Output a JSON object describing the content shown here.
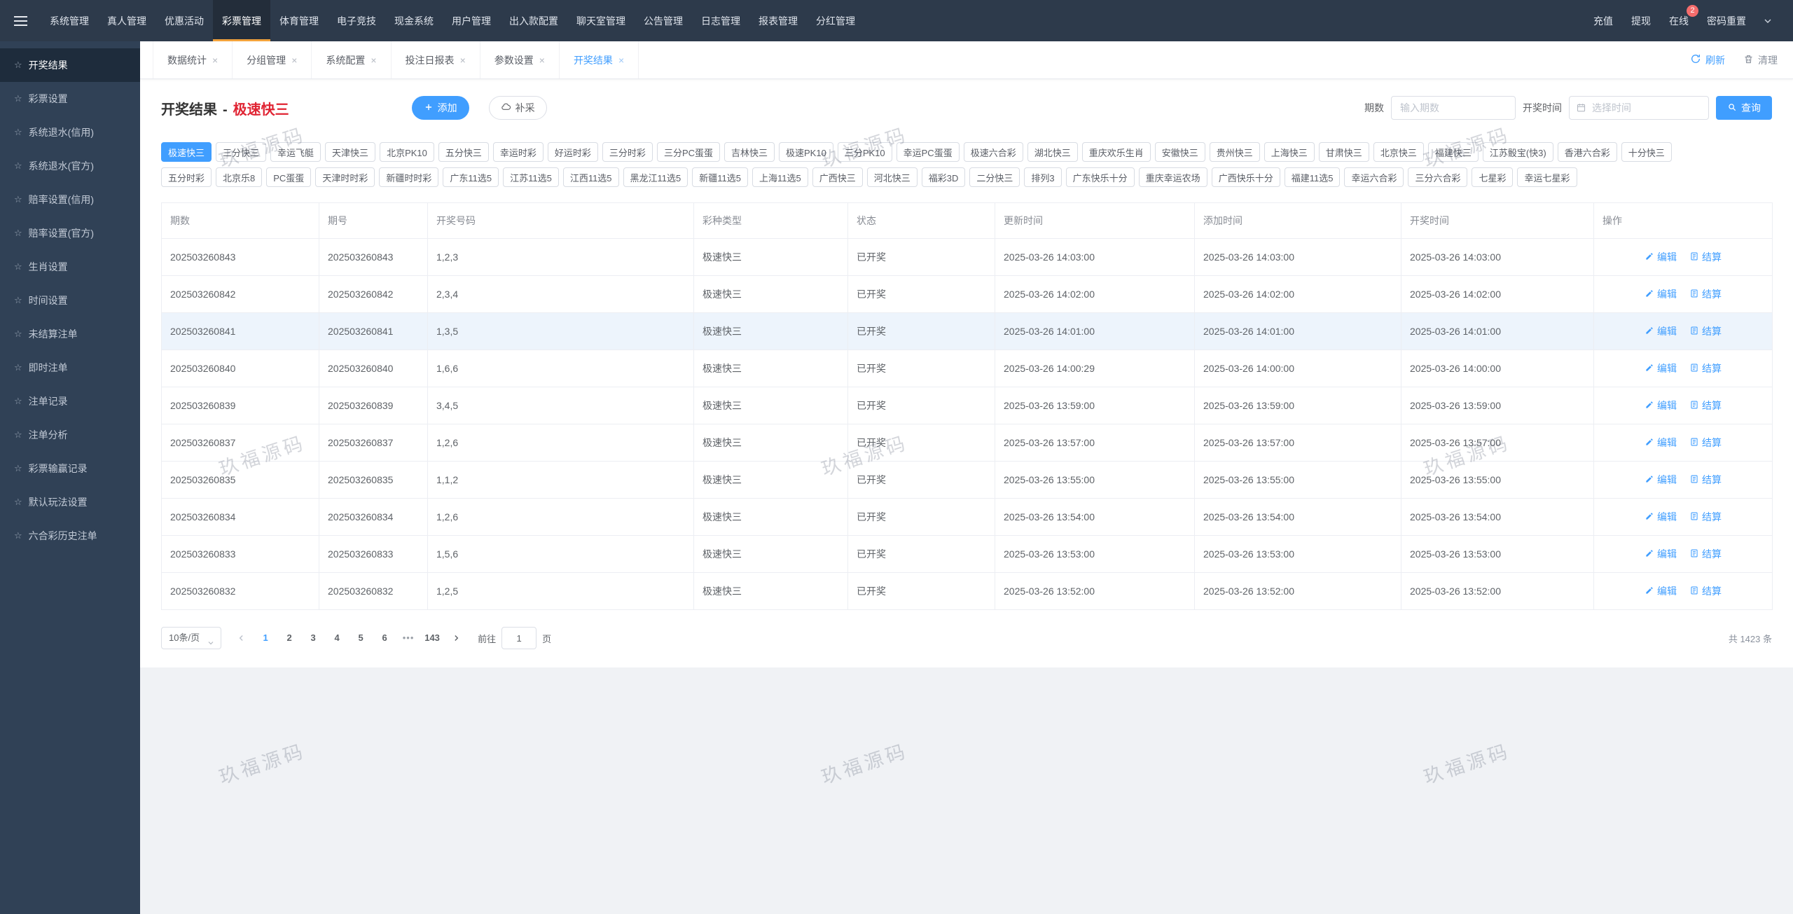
{
  "navbar": {
    "menu": [
      "系统管理",
      "真人管理",
      "优惠活动",
      "彩票管理",
      "体育管理",
      "电子竞技",
      "现金系统",
      "用户管理",
      "出入款配置",
      "聊天室管理",
      "公告管理",
      "日志管理",
      "报表管理",
      "分红管理"
    ],
    "active": "彩票管理",
    "right_items": [
      {
        "label": "充值"
      },
      {
        "label": "提现"
      },
      {
        "label": "在线",
        "badge": "2"
      },
      {
        "label": "密码重置"
      }
    ]
  },
  "sidebar": {
    "items": [
      "开奖结果",
      "彩票设置",
      "系统退水(信用)",
      "系统退水(官方)",
      "赔率设置(信用)",
      "赔率设置(官方)",
      "生肖设置",
      "时间设置",
      "未结算注单",
      "即时注单",
      "注单记录",
      "注单分析",
      "彩票输赢记录",
      "默认玩法设置",
      "六合彩历史注单"
    ],
    "active": "开奖结果"
  },
  "tabs": {
    "items": [
      "数据统计",
      "分组管理",
      "系统配置",
      "投注日报表",
      "参数设置",
      "开奖结果"
    ],
    "active": "开奖结果",
    "refresh_label": "刷新",
    "clear_label": "清理"
  },
  "page": {
    "title": "开奖结果",
    "title_separator": "-",
    "title_highlight": "极速快三",
    "add_button": "添加",
    "collect_button": "补采",
    "period_label": "期数",
    "period_placeholder": "输入期数",
    "time_label": "开奖时间",
    "time_placeholder": "选择时间",
    "search_button": "查询"
  },
  "filters": {
    "active": "极速快三",
    "row1": [
      "极速快三",
      "三分快三",
      "幸运飞艇",
      "天津快三",
      "北京PK10",
      "五分快三",
      "幸运时彩",
      "好运时彩",
      "三分时彩",
      "三分PC蛋蛋",
      "吉林快三",
      "极速PK10",
      "三分PK10",
      "幸运PC蛋蛋",
      "极速六合彩",
      "湖北快三",
      "重庆欢乐生肖",
      "安徽快三",
      "贵州快三",
      "上海快三",
      "甘肃快三",
      "北京快三",
      "福建快三",
      "江苏骰宝(快3)",
      "香港六合彩",
      "十分快三"
    ],
    "row2": [
      "五分时彩",
      "北京乐8",
      "PC蛋蛋",
      "天津时时彩",
      "新疆时时彩",
      "广东11选5",
      "江苏11选5",
      "江西11选5",
      "黑龙江11选5",
      "新疆11选5",
      "上海11选5",
      "广西快三",
      "河北快三",
      "福彩3D",
      "二分快三",
      "排列3",
      "广东快乐十分",
      "重庆幸运农场",
      "广西快乐十分",
      "福建11选5",
      "幸运六合彩",
      "三分六合彩",
      "七星彩",
      "幸运七星彩"
    ]
  },
  "table": {
    "columns": [
      "期数",
      "期号",
      "开奖号码",
      "彩种类型",
      "状态",
      "更新时间",
      "添加时间",
      "开奖时间",
      "操作"
    ],
    "edit_label": "编辑",
    "settle_label": "结算",
    "rows": [
      {
        "period": "202503260843",
        "issue": "202503260843",
        "codes": "1,2,3",
        "type": "极速快三",
        "status": "已开奖",
        "updated": "2025-03-26 14:03:00",
        "added": "2025-03-26 14:03:00",
        "opened": "2025-03-26 14:03:00",
        "highlight": false
      },
      {
        "period": "202503260842",
        "issue": "202503260842",
        "codes": "2,3,4",
        "type": "极速快三",
        "status": "已开奖",
        "updated": "2025-03-26 14:02:00",
        "added": "2025-03-26 14:02:00",
        "opened": "2025-03-26 14:02:00",
        "highlight": false
      },
      {
        "period": "202503260841",
        "issue": "202503260841",
        "codes": "1,3,5",
        "type": "极速快三",
        "status": "已开奖",
        "updated": "2025-03-26 14:01:00",
        "added": "2025-03-26 14:01:00",
        "opened": "2025-03-26 14:01:00",
        "highlight": true
      },
      {
        "period": "202503260840",
        "issue": "202503260840",
        "codes": "1,6,6",
        "type": "极速快三",
        "status": "已开奖",
        "updated": "2025-03-26 14:00:29",
        "added": "2025-03-26 14:00:00",
        "opened": "2025-03-26 14:00:00",
        "highlight": false
      },
      {
        "period": "202503260839",
        "issue": "202503260839",
        "codes": "3,4,5",
        "type": "极速快三",
        "status": "已开奖",
        "updated": "2025-03-26 13:59:00",
        "added": "2025-03-26 13:59:00",
        "opened": "2025-03-26 13:59:00",
        "highlight": false
      },
      {
        "period": "202503260837",
        "issue": "202503260837",
        "codes": "1,2,6",
        "type": "极速快三",
        "status": "已开奖",
        "updated": "2025-03-26 13:57:00",
        "added": "2025-03-26 13:57:00",
        "opened": "2025-03-26 13:57:00",
        "highlight": false
      },
      {
        "period": "202503260835",
        "issue": "202503260835",
        "codes": "1,1,2",
        "type": "极速快三",
        "status": "已开奖",
        "updated": "2025-03-26 13:55:00",
        "added": "2025-03-26 13:55:00",
        "opened": "2025-03-26 13:55:00",
        "highlight": false
      },
      {
        "period": "202503260834",
        "issue": "202503260834",
        "codes": "1,2,6",
        "type": "极速快三",
        "status": "已开奖",
        "updated": "2025-03-26 13:54:00",
        "added": "2025-03-26 13:54:00",
        "opened": "2025-03-26 13:54:00",
        "highlight": false
      },
      {
        "period": "202503260833",
        "issue": "202503260833",
        "codes": "1,5,6",
        "type": "极速快三",
        "status": "已开奖",
        "updated": "2025-03-26 13:53:00",
        "added": "2025-03-26 13:53:00",
        "opened": "2025-03-26 13:53:00",
        "highlight": false
      },
      {
        "period": "202503260832",
        "issue": "202503260832",
        "codes": "1,2,5",
        "type": "极速快三",
        "status": "已开奖",
        "updated": "2025-03-26 13:52:00",
        "added": "2025-03-26 13:52:00",
        "opened": "2025-03-26 13:52:00",
        "highlight": false
      }
    ]
  },
  "pagination": {
    "page_size": "10条/页",
    "pages": [
      "1",
      "2",
      "3",
      "4",
      "5",
      "6",
      "•••",
      "143"
    ],
    "active_page": "1",
    "ellipsis": "•••",
    "goto_label": "前往",
    "goto_value": "1",
    "goto_suffix": "页",
    "total": "共 1423 条"
  },
  "watermark": {
    "text": "玖福源码"
  }
}
